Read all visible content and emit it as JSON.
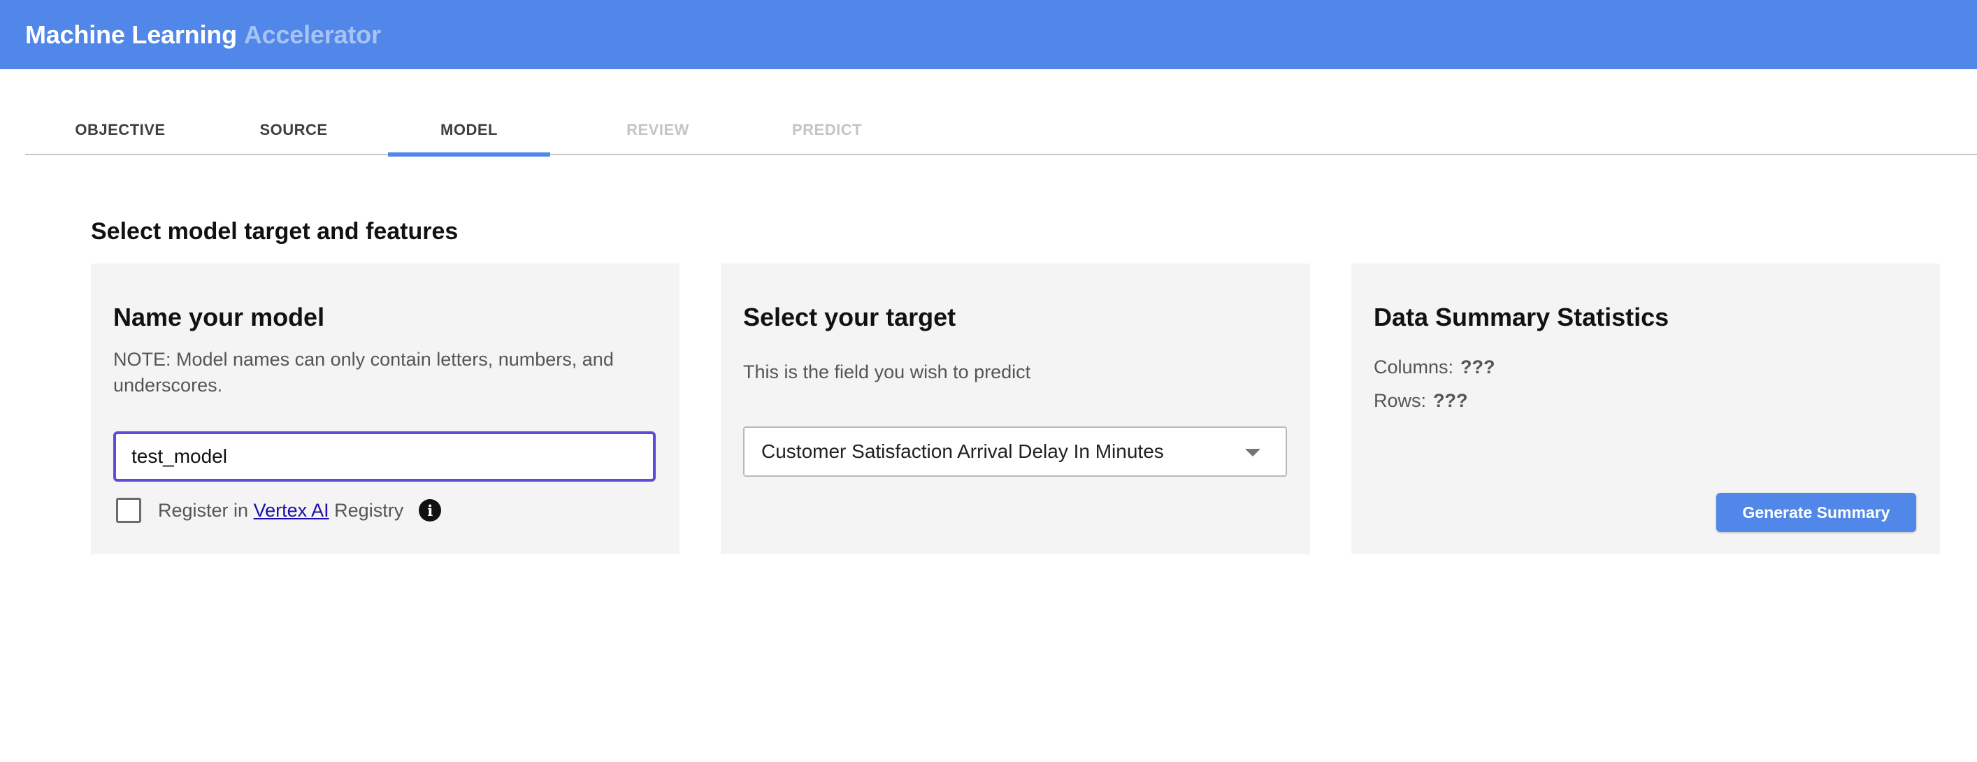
{
  "header": {
    "title_main": "Machine Learning",
    "title_sub": "Accelerator"
  },
  "tabs": [
    {
      "label": "OBJECTIVE",
      "state": "enabled"
    },
    {
      "label": "SOURCE",
      "state": "enabled"
    },
    {
      "label": "MODEL",
      "state": "active"
    },
    {
      "label": "REVIEW",
      "state": "disabled"
    },
    {
      "label": "PREDICT",
      "state": "disabled"
    }
  ],
  "main": {
    "section_title": "Select model target and features"
  },
  "name_card": {
    "title": "Name your model",
    "note": "NOTE: Model names can only contain letters, numbers, and underscores.",
    "input_value": "test_model",
    "register_prefix": "Register in",
    "register_link": "Vertex AI",
    "register_suffix": "Registry",
    "info_icon": "info-icon",
    "register_checked": false
  },
  "target_card": {
    "title": "Select your target",
    "description": "This is the field you wish to predict",
    "selected_target": "Customer Satisfaction Arrival Delay In Minutes",
    "dropdown_icon": "chevron-down-icon"
  },
  "stats_card": {
    "title": "Data Summary Statistics",
    "columns_label": "Columns:",
    "columns_value": "???",
    "rows_label": "Rows:",
    "rows_value": "???",
    "button_label": "Generate Summary"
  },
  "colors": {
    "accent": "#5087e8",
    "header_sub_text": "#a7c3f3",
    "input_focus_border": "#5b4ddb",
    "card_background": "#f4f4f4",
    "link": "#1a0dab"
  }
}
